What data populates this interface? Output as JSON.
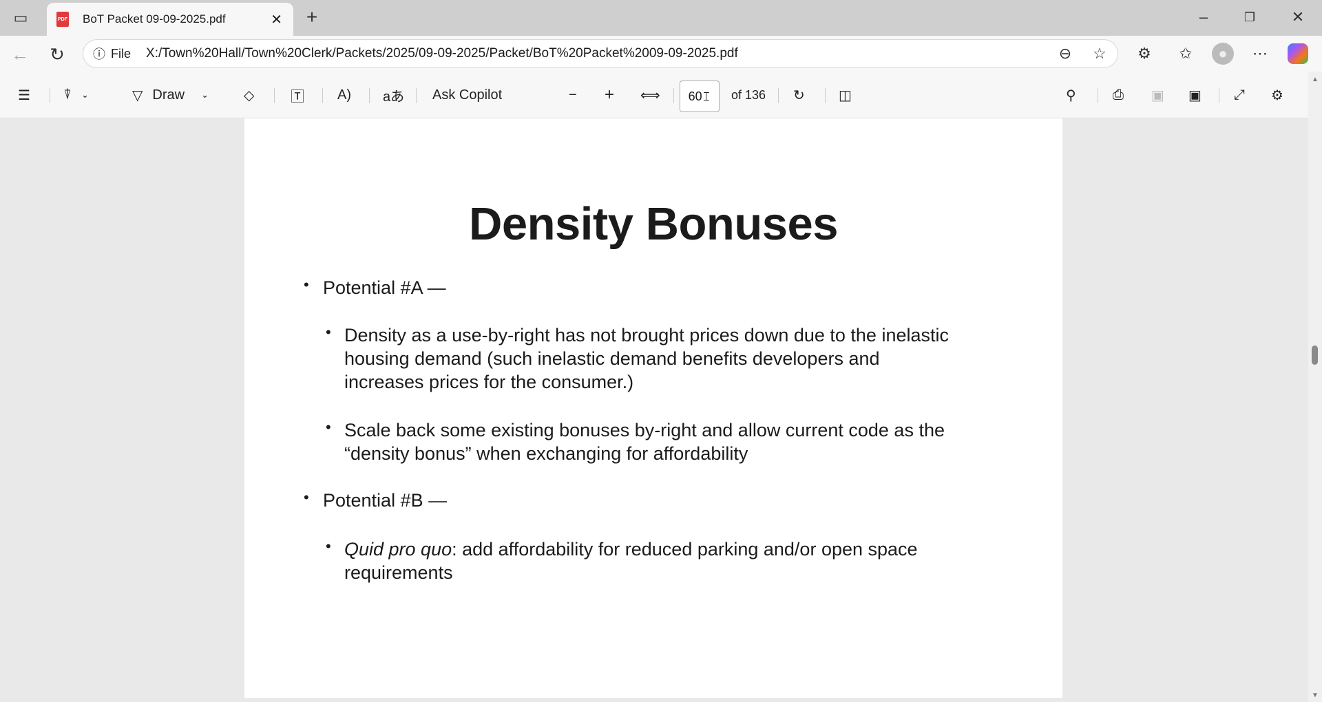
{
  "tab": {
    "title": "BoT Packet 09-09-2025.pdf"
  },
  "address": {
    "scheme_label": "File",
    "url": "X:/Town%20Hall/Town%20Clerk/Packets/2025/09-09-2025/Packet/BoT%20Packet%2009-09-2025.pdf"
  },
  "toolbar": {
    "draw_label": "Draw",
    "ask_copilot": "Ask Copilot",
    "page_number": "60",
    "page_total": "of 136"
  },
  "document": {
    "title": "Density Bonuses",
    "items": [
      {
        "label": "Potential #A —",
        "subitems": [
          {
            "lines": [
              "Density as a use-by-right has not brought prices down due to the inelastic",
              "housing demand (such inelastic demand benefits developers and",
              "increases prices for the consumer.)"
            ]
          },
          {
            "lines": [
              "Scale back some existing bonuses by-right and allow current code as the",
              "“density bonus” when exchanging for affordability"
            ]
          }
        ]
      },
      {
        "label": "Potential #B —",
        "subitems": [
          {
            "italic": "Quid pro quo",
            "lines": [
              ": add affordability for reduced parking and/or open space",
              "requirements"
            ]
          }
        ]
      }
    ]
  }
}
